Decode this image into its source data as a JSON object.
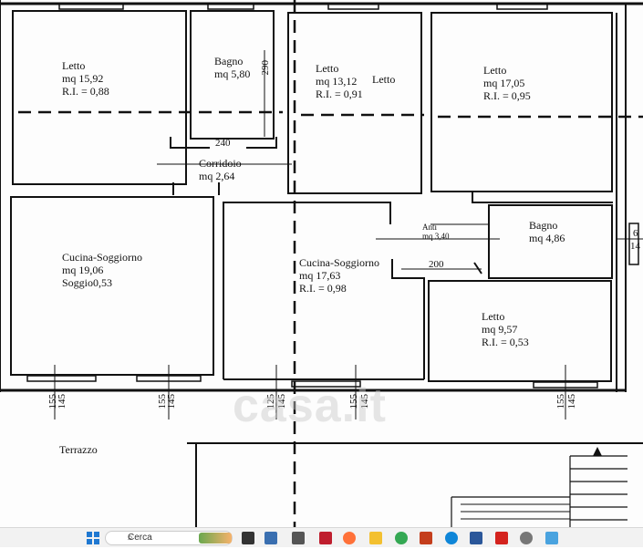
{
  "rooms": [
    {
      "id": "letto-1",
      "lines": [
        "Letto",
        "mq 15,92",
        "R.I. = 0,88"
      ]
    },
    {
      "id": "bagno-1",
      "lines": [
        "Bagno",
        "mq 5,80"
      ]
    },
    {
      "id": "letto-2",
      "lines": [
        "Letto",
        "mq 13,12",
        "R.I. = 0,91"
      ]
    },
    {
      "id": "letto-2-extra",
      "lines": [
        "Letto"
      ]
    },
    {
      "id": "letto-3",
      "lines": [
        "Letto",
        "mq 17,05",
        "R.I. = 0,95"
      ]
    },
    {
      "id": "corridoio",
      "lines": [
        "Corridoio",
        "mq 2,64"
      ]
    },
    {
      "id": "cucina-1",
      "lines": [
        "Cucina-Soggiorno",
        "mq 19,06",
        "Soggio0,53"
      ]
    },
    {
      "id": "cucina-2",
      "lines": [
        "Cucina-Soggiorno",
        "mq 17,63",
        "R.I. = 0,98"
      ]
    },
    {
      "id": "anti",
      "lines": [
        "Anti",
        "mq 3,40"
      ]
    },
    {
      "id": "bagno-2",
      "lines": [
        "Bagno",
        "mq 4,86"
      ]
    },
    {
      "id": "letto-4",
      "lines": [
        "Letto",
        "mq 9,57",
        "R.I. = 0,53"
      ]
    },
    {
      "id": "terrazzo",
      "lines": [
        "Terrazzo"
      ]
    }
  ],
  "dimensions": {
    "d240": "240",
    "d290": "290",
    "d200": "200",
    "d6": "6",
    "d14": "14",
    "d155a": "155",
    "d145a": "145",
    "d155b": "155",
    "d145b": "145",
    "d125": "125",
    "d145c": "145",
    "d155c": "155",
    "d145d": "145",
    "d155d": "155",
    "d145e": "145"
  },
  "watermark": "casa.it",
  "taskbar": {
    "search_placeholder": "Cerca",
    "icons": [
      "windows-start-icon",
      "search-icon",
      "widgets-icon",
      "taskview-icon",
      "file-explorer-icon",
      "filezilla-icon",
      "firefox-icon",
      "folder-icon",
      "chrome-icon",
      "powerpoint-icon",
      "edge-icon",
      "word-icon",
      "acrobat-icon",
      "settings-icon",
      "photos-icon"
    ],
    "colors": {
      "windows": "#1f78d1",
      "filezilla": "#bf1e2e",
      "firefox": "#ff7139",
      "folder": "#f3c030",
      "chrome": "#34a853",
      "powerpoint": "#c43e1c",
      "edge": "#0f86d8",
      "word": "#2b579a",
      "acrobat": "#d4231e"
    }
  }
}
